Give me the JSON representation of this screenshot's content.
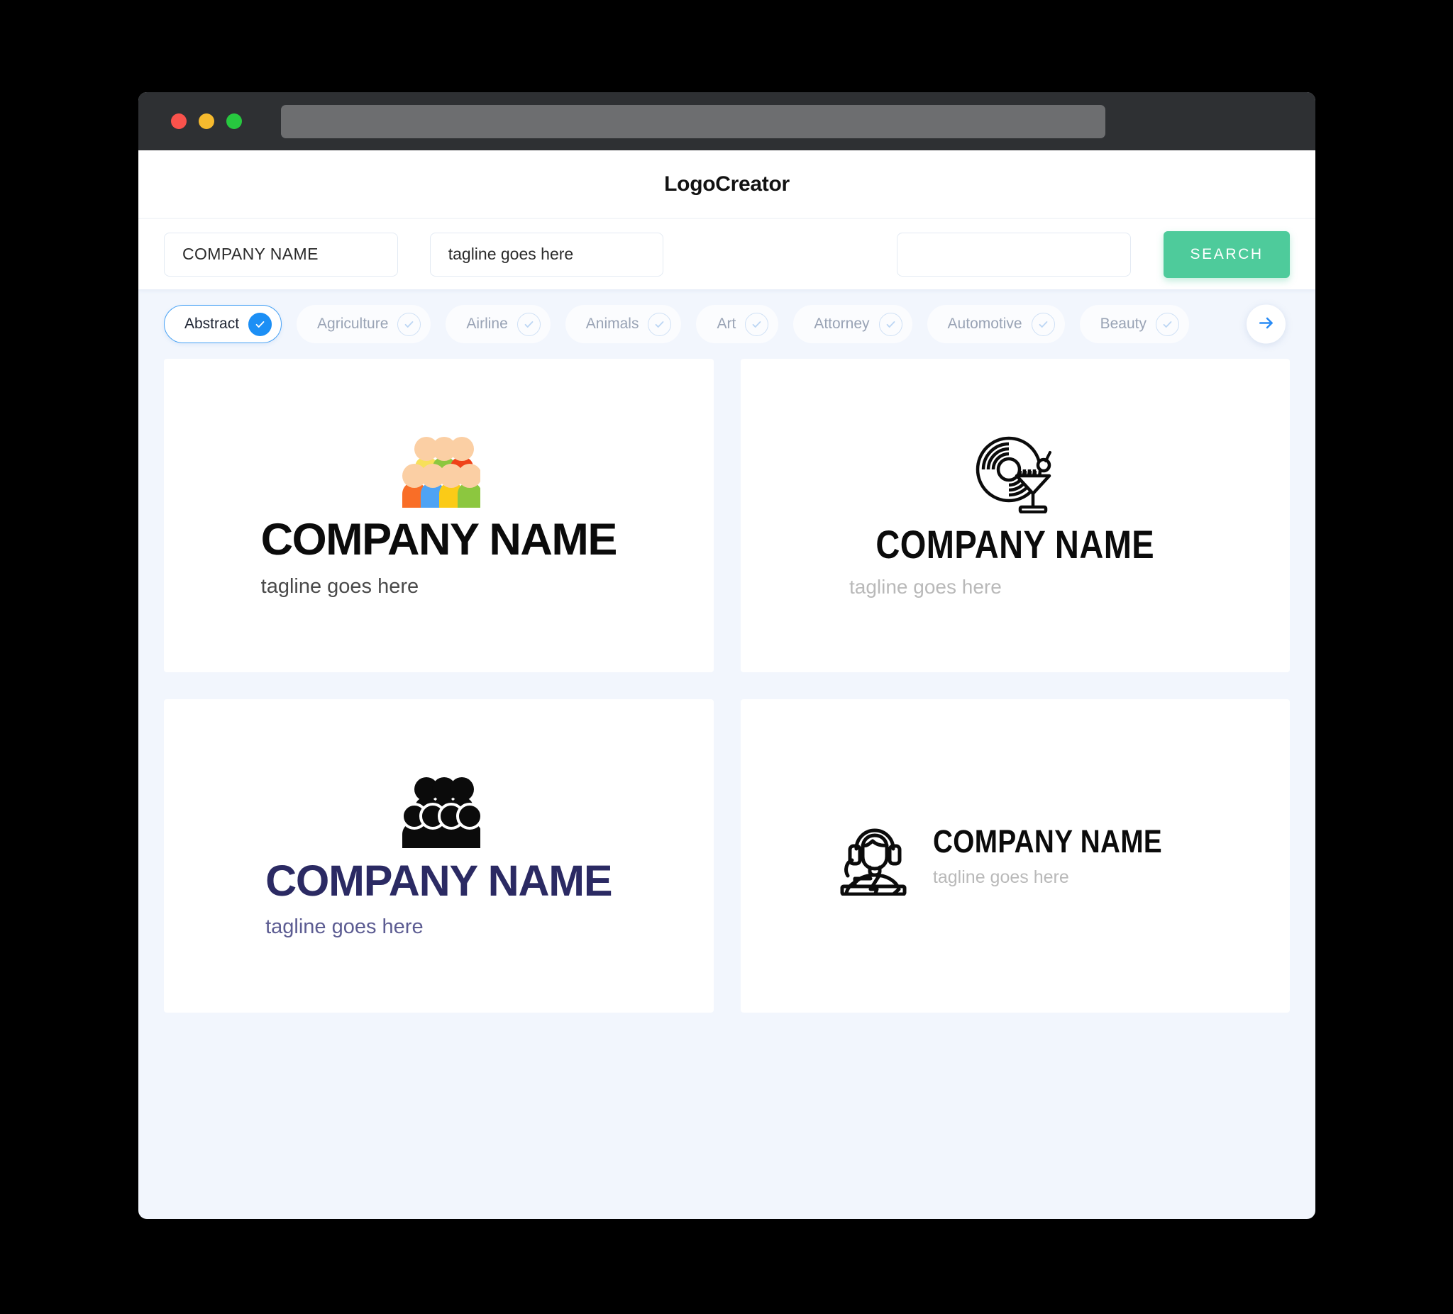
{
  "window": {
    "traffic_lights": [
      "close",
      "minimize",
      "maximize"
    ],
    "url_value": ""
  },
  "header": {
    "title": "LogoCreator"
  },
  "search": {
    "company_value": "COMPANY NAME",
    "company_placeholder": "COMPANY NAME",
    "tagline_value": "tagline goes here",
    "tagline_placeholder": "tagline goes here",
    "keyword_value": "",
    "keyword_placeholder": "",
    "button_label": "SEARCH",
    "button_color": "#4ECB9B"
  },
  "categories": {
    "selected": "Abstract",
    "accent_color": "#1C8FF5",
    "next_label": "next",
    "items": [
      {
        "label": "Abstract",
        "selected": true
      },
      {
        "label": "Agriculture",
        "selected": false
      },
      {
        "label": "Airline",
        "selected": false
      },
      {
        "label": "Animals",
        "selected": false
      },
      {
        "label": "Art",
        "selected": false
      },
      {
        "label": "Attorney",
        "selected": false
      },
      {
        "label": "Automotive",
        "selected": false
      },
      {
        "label": "Beauty",
        "selected": false
      }
    ]
  },
  "results": [
    {
      "mark": "colorful-people-group-icon",
      "company_name": "COMPANY NAME",
      "tagline": "tagline goes here",
      "name_color": "#0B0B0B",
      "tagline_color": "#4A4A4A",
      "layout": "stacked"
    },
    {
      "mark": "vinyl-record-cocktail-icon",
      "company_name": "COMPANY NAME",
      "tagline": "tagline goes here",
      "name_color": "#0B0B0B",
      "tagline_color": "#B9B9B9",
      "layout": "stacked"
    },
    {
      "mark": "black-people-group-icon",
      "company_name": "COMPANY NAME",
      "tagline": "tagline goes here",
      "name_color": "#2B2A63",
      "tagline_color": "#5C5C92",
      "layout": "stacked"
    },
    {
      "mark": "dj-headphones-icon",
      "company_name": "COMPANY NAME",
      "tagline": "tagline goes here",
      "name_color": "#0B0B0B",
      "tagline_color": "#B9B9B9",
      "layout": "horizontal"
    }
  ]
}
